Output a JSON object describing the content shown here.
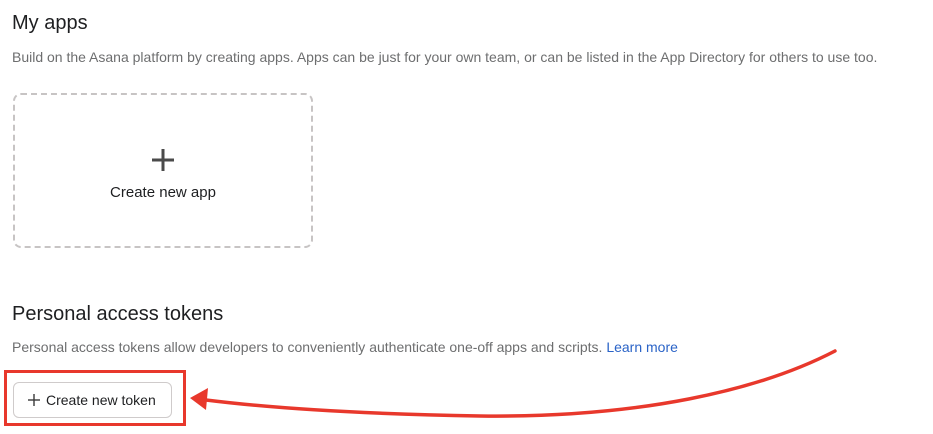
{
  "my_apps": {
    "title": "My apps",
    "description": "Build on the Asana platform by creating apps. Apps can be just for your own team, or can be listed in the App Directory for others to use too.",
    "create_app_label": "Create new app",
    "create_app_icon": "plus-icon"
  },
  "personal_access_tokens": {
    "title": "Personal access tokens",
    "description": "Personal access tokens allow developers to conveniently authenticate one-off apps and scripts.",
    "learn_more_label": "Learn more",
    "create_token_label": "Create new token",
    "create_token_icon": "plus-icon"
  },
  "colors": {
    "link": "#2a63c7",
    "annotation": "#e8382c",
    "muted_text": "#6d6e6f",
    "dashed_border": "#c7c4c4"
  }
}
